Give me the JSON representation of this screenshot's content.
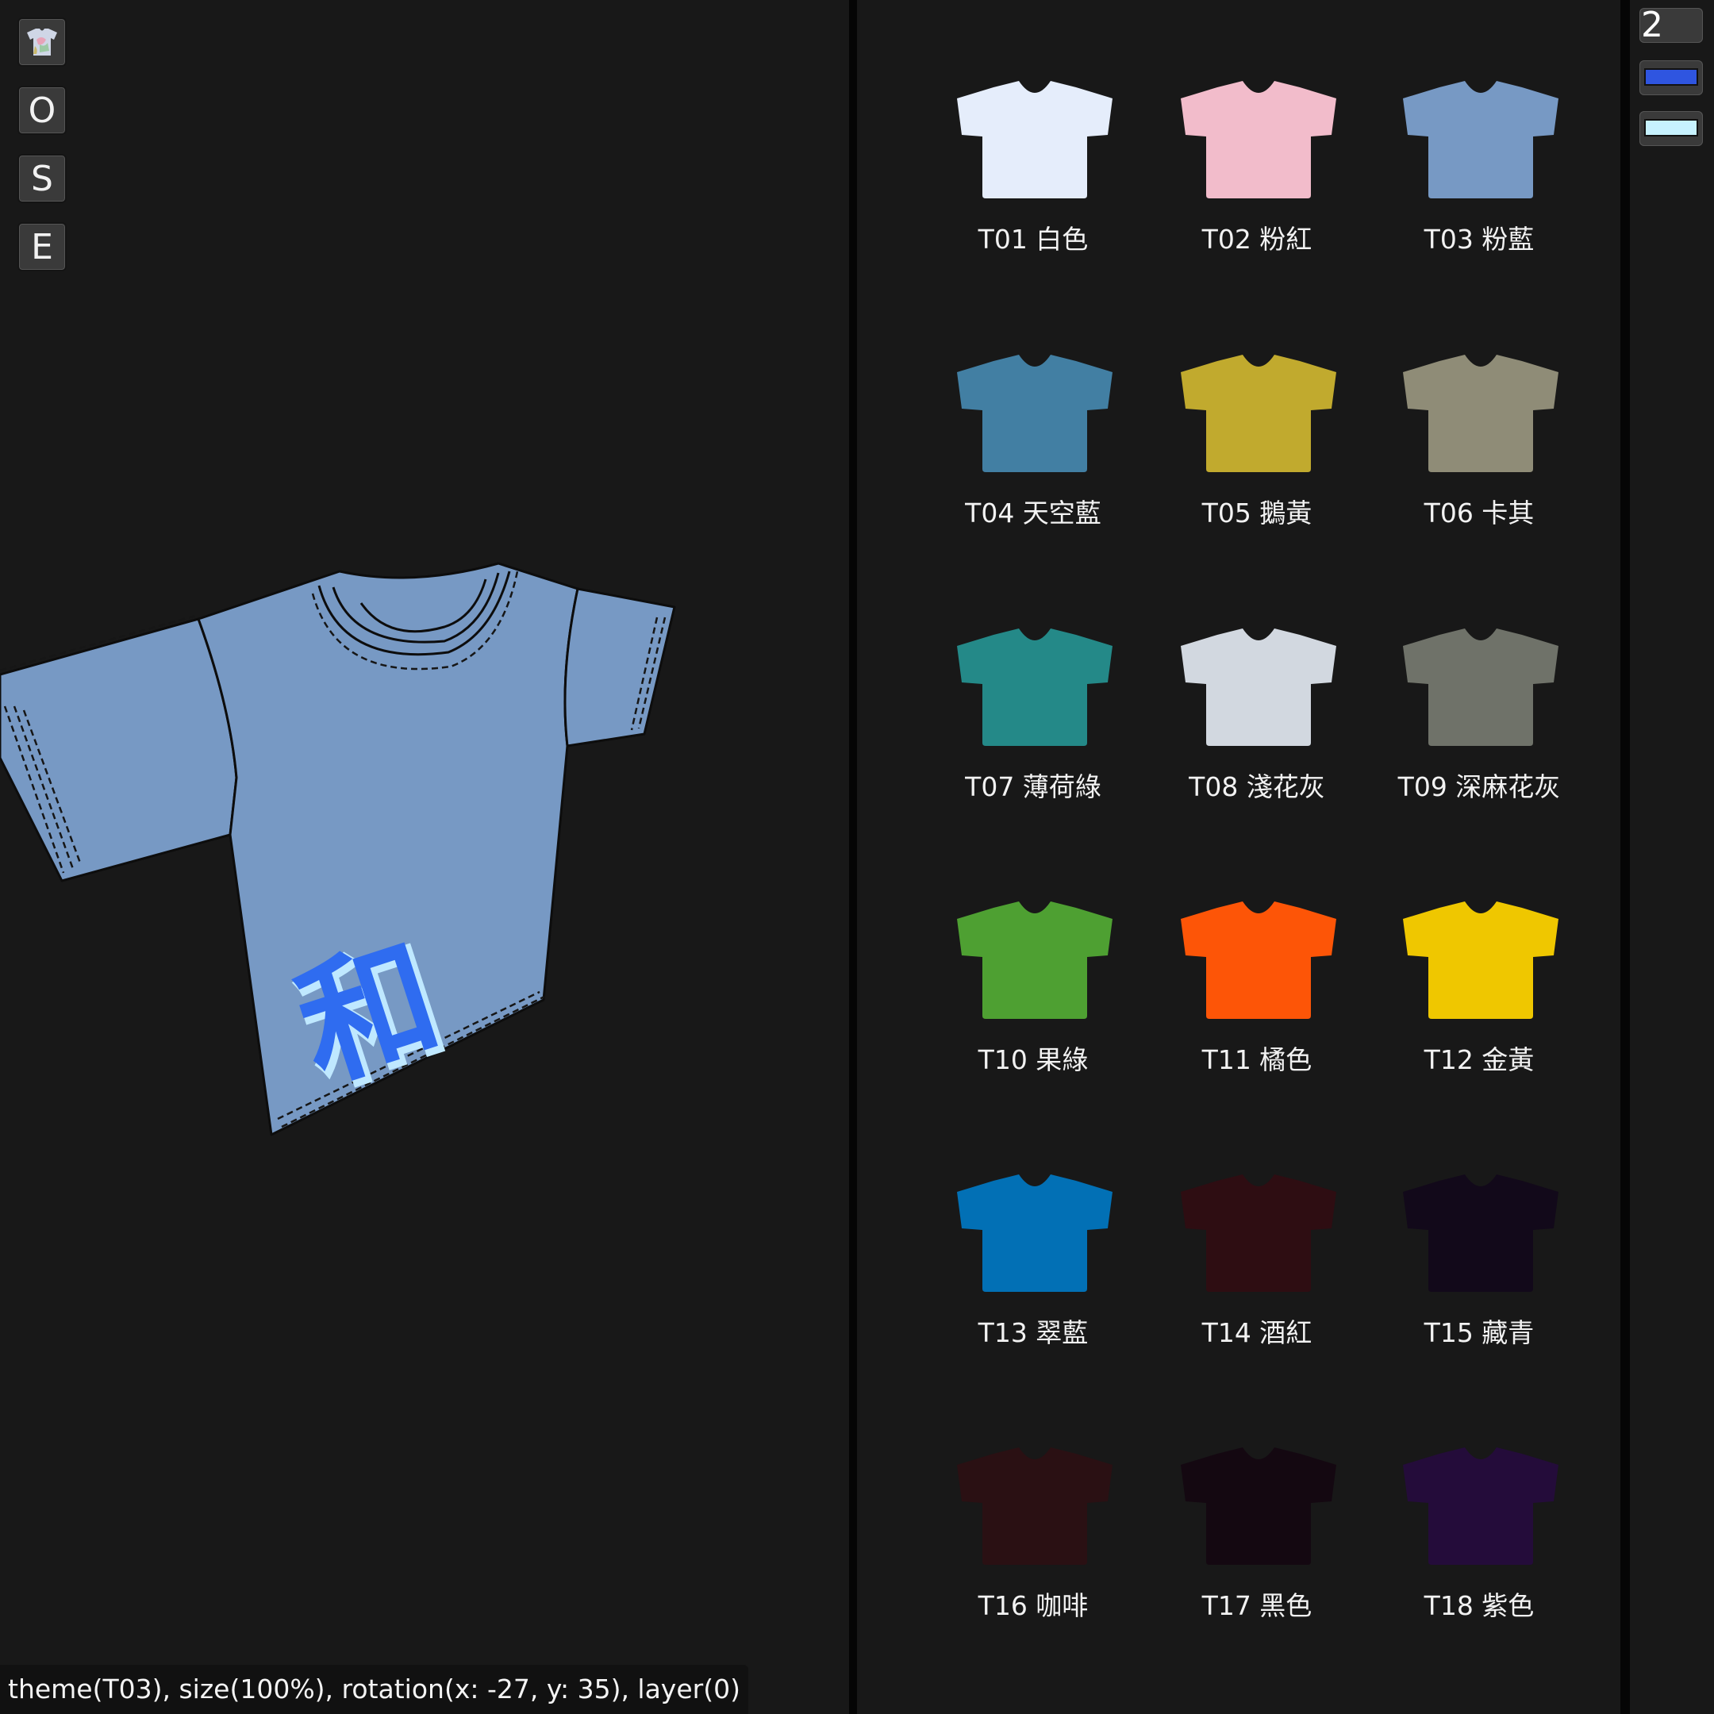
{
  "toolbar": {
    "buttons": [
      {
        "id": "theme",
        "icon": "tshirt-thumbnail-icon",
        "label": ""
      },
      {
        "id": "o",
        "icon": "",
        "label": "O"
      },
      {
        "id": "s",
        "icon": "",
        "label": "S"
      },
      {
        "id": "e",
        "icon": "",
        "label": "E"
      }
    ]
  },
  "preview": {
    "shirt_color": "#7799c4",
    "print_glyph": "和",
    "print_color": "#2f6cf0",
    "print_highlight": "#bfe8ff"
  },
  "status": {
    "text": "theme(T03), size(100%), rotation(x: -27, y: 35), layer(0)"
  },
  "right_panel": {
    "size_value": "2",
    "primary_color": "#2f55e0",
    "secondary_color": "#c7f2ff"
  },
  "catalog": {
    "items": [
      {
        "code": "T01",
        "label": "T01 白色",
        "color": "#e5edfb"
      },
      {
        "code": "T02",
        "label": "T02 粉紅",
        "color": "#f2bccb"
      },
      {
        "code": "T03",
        "label": "T03 粉藍",
        "color": "#7799c4"
      },
      {
        "code": "T04",
        "label": "T04 天空藍",
        "color": "#427fa3"
      },
      {
        "code": "T05",
        "label": "T05 鵝黃",
        "color": "#c1aa2e"
      },
      {
        "code": "T06",
        "label": "T06 卡其",
        "color": "#8f8c77"
      },
      {
        "code": "T07",
        "label": "T07 薄荷綠",
        "color": "#248988"
      },
      {
        "code": "T08",
        "label": "T08 淺花灰",
        "color": "#d2d8e0"
      },
      {
        "code": "T09",
        "label": "T09 深麻花灰",
        "color": "#6f7269"
      },
      {
        "code": "T10",
        "label": "T10 果綠",
        "color": "#4ea032"
      },
      {
        "code": "T11",
        "label": "T11 橘色",
        "color": "#fd5507"
      },
      {
        "code": "T12",
        "label": "T12 金黃",
        "color": "#efc700"
      },
      {
        "code": "T13",
        "label": "T13 翠藍",
        "color": "#0270b5"
      },
      {
        "code": "T14",
        "label": "T14 酒紅",
        "color": "#2e0d12"
      },
      {
        "code": "T15",
        "label": "T15 藏青",
        "color": "#12091a"
      },
      {
        "code": "T16",
        "label": "T16 咖啡",
        "color": "#2a1013"
      },
      {
        "code": "T17",
        "label": "T17 黑色",
        "color": "#140811"
      },
      {
        "code": "T18",
        "label": "T18 紫色",
        "color": "#240c3a"
      }
    ]
  }
}
